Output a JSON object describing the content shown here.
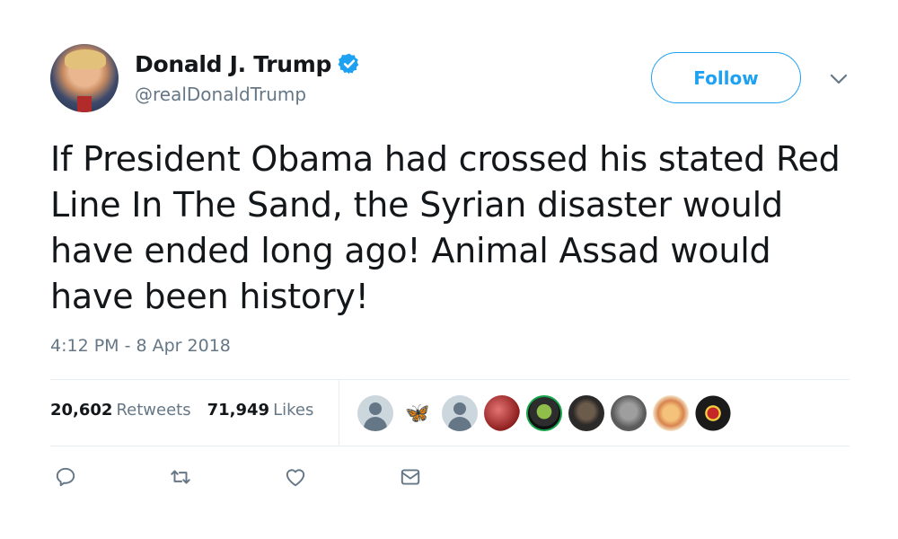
{
  "user": {
    "name": "Donald J. Trump",
    "handle": "@realDonaldTrump",
    "verified": true
  },
  "follow_button": {
    "label": "Follow"
  },
  "tweet": {
    "text": "If President Obama had crossed his stated Red Line In The Sand, the Syrian disaster would have ended long ago! Animal Assad would have been history!",
    "timestamp": "4:12 PM - 8 Apr 2018"
  },
  "stats": {
    "retweets_count": "20,602",
    "retweets_label": "Retweets",
    "likes_count": "71,949",
    "likes_label": "Likes"
  },
  "liker_avatars": [
    "default",
    "butterfly",
    "default",
    "red",
    "green",
    "dark",
    "gray",
    "food",
    "badge"
  ],
  "actions": [
    "reply-icon",
    "retweet-icon",
    "like-icon",
    "direct-message-icon"
  ],
  "colors": {
    "accent": "#1da1f2",
    "secondary_text": "#657786",
    "primary_text": "#14171a",
    "divider": "#e6ecf0"
  }
}
